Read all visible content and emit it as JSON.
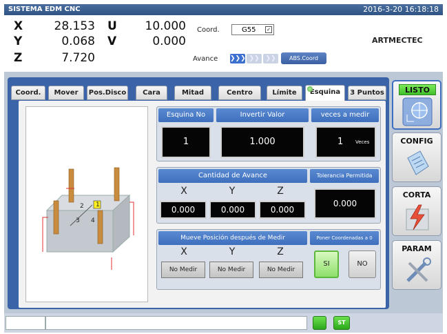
{
  "header": {
    "app_title": "SISTEMA EDM CNC",
    "datetime": "2016-3-20 16:18:18"
  },
  "coords": {
    "x_label": "X",
    "x_value": "28.153",
    "y_label": "Y",
    "y_value": "0.068",
    "z_label": "Z",
    "z_value": "7.720",
    "u_label": "U",
    "u_value": "10.000",
    "v_label": "V",
    "v_value": "0.000",
    "coord_label": "Coord.",
    "coord_system": "G55",
    "avance_label": "Avance",
    "abs_coord_label": "ABS.Coord",
    "speed_level": 1,
    "brand": "ARTMECTEC"
  },
  "tabs": [
    {
      "label": "Coord."
    },
    {
      "label": "Mover"
    },
    {
      "label": "Pos.Disco"
    },
    {
      "label": "Cara"
    },
    {
      "label": "Mitad"
    },
    {
      "label": "Centro"
    },
    {
      "label": "Límite"
    },
    {
      "label": "Esquina"
    },
    {
      "label": "3 Puntos"
    }
  ],
  "active_tab": "Esquina",
  "illustration": {
    "label_2": "2",
    "label_1": "1",
    "label_3": "3",
    "label_4": "4"
  },
  "corner": {
    "esquina_no_label": "Esquina No",
    "esquina_no_value": "1",
    "invertir_label": "Invertir Valor",
    "invertir_value": "1.000",
    "veces_label": "veces a medir",
    "veces_value": "1",
    "veces_unit": "Veces"
  },
  "avance": {
    "title": "Cantidad de Avance",
    "x_label": "X",
    "y_label": "Y",
    "z_label": "Z",
    "x_value": "0.000",
    "y_value": "0.000",
    "z_value": "0.000",
    "tolerancia_label": "Tolerancia Permitida",
    "tolerancia_value": "0.000"
  },
  "mueve": {
    "title": "Mueve Posición después de Medir",
    "x_label": "X",
    "y_label": "Y",
    "z_label": "Z",
    "x_btn": "No Medir",
    "y_btn": "No Medir",
    "z_btn": "No Medir",
    "poner_label": "Poner Coordenadas a 0",
    "si_label": "SI",
    "no_label": "NO"
  },
  "side": {
    "listo": "LISTO",
    "config": "CONFIG",
    "corta": "CORTA",
    "param": "PARAM"
  },
  "status": {
    "st_label": "ST"
  },
  "colors": {
    "accent_blue": "#3e6fbe",
    "ready_green": "#3fbf2a",
    "panel_bg": "#bcc8d6"
  }
}
